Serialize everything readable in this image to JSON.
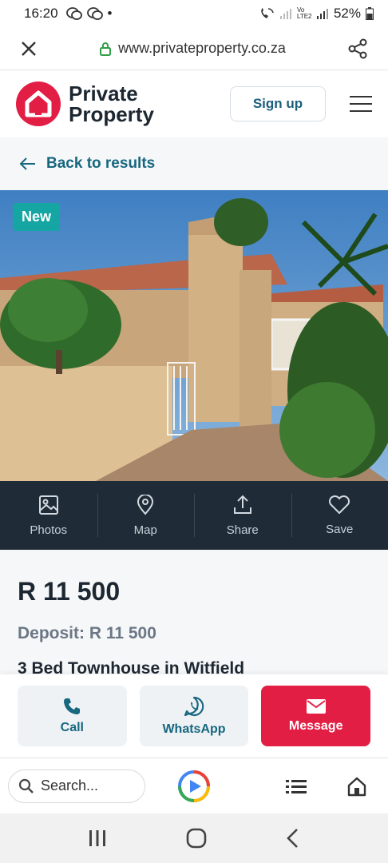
{
  "status_bar": {
    "time": "16:20",
    "dot": "•",
    "battery": "52%",
    "network": "Vo LTE2",
    "icons": [
      "wechat-icon",
      "wechat-icon",
      "wifi-call-icon",
      "signal-icon",
      "signal-icon",
      "battery-icon"
    ]
  },
  "url_bar": {
    "url": "www.privateproperty.co.za",
    "icons": [
      "close-icon",
      "lock-icon",
      "share-icon"
    ]
  },
  "header": {
    "logo_line1": "Private",
    "logo_line2": "Property",
    "signup_label": "Sign up",
    "menu_icon": "hamburger-icon"
  },
  "back_link": {
    "label": "Back to results",
    "icon": "arrow-left-icon"
  },
  "listing_photo": {
    "badge": "New"
  },
  "media_bar": {
    "items": [
      {
        "label": "Photos",
        "icon": "image-icon"
      },
      {
        "label": "Map",
        "icon": "map-pin-icon"
      },
      {
        "label": "Share",
        "icon": "upload-icon"
      },
      {
        "label": "Save",
        "icon": "heart-icon"
      }
    ]
  },
  "listing": {
    "price": "R 11 500",
    "deposit": "Deposit: R 11 500",
    "title": "3 Bed Townhouse in Witfield"
  },
  "actions": {
    "call_label": "Call",
    "whatsapp_label": "WhatsApp",
    "message_label": "Message"
  },
  "browser_bar": {
    "search_placeholder": "Search...",
    "icons": [
      "search-icon",
      "google-assistant-icon",
      "tabs-icon",
      "home-icon"
    ]
  },
  "nav_bar": {
    "icons": [
      "recent-apps-icon",
      "home-circle-icon",
      "back-chevron-icon"
    ]
  },
  "colors": {
    "brand_red": "#e31e45",
    "teal_link": "#17677f",
    "badge_teal": "#15a6a3",
    "dark_bar": "#1f2b36"
  }
}
